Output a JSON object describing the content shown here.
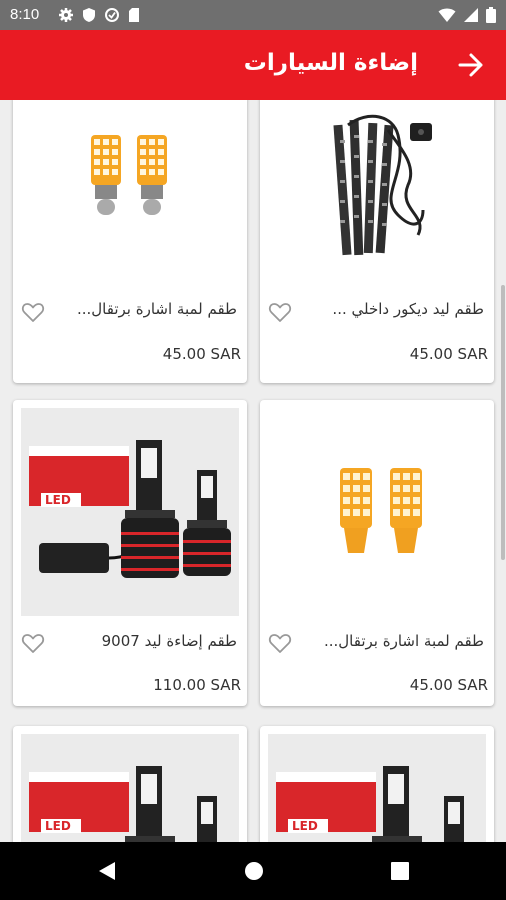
{
  "status": {
    "time": "8:10"
  },
  "header": {
    "title": "إضاءة السيارات"
  },
  "products": [
    {
      "name": "طقم ليد ديكور داخلي ...",
      "price": "45.00 SAR",
      "image": "led-strip-kit"
    },
    {
      "name": "طقم لمبة اشارة برتقال...",
      "price": "45.00 SAR",
      "image": "orange-signal-bulbs-1156"
    },
    {
      "name": "طقم لمبة اشارة برتقال...",
      "price": "45.00 SAR",
      "image": "orange-signal-bulbs-7440"
    },
    {
      "name": "طقم إضاءة ليد 9007",
      "price": "110.00 SAR",
      "image": "led-headlight-kit"
    },
    {
      "name": "",
      "price": "",
      "image": "led-headlight-kit"
    },
    {
      "name": "",
      "price": "",
      "image": "led-headlight-kit"
    }
  ],
  "colors": {
    "accent": "#e91b23",
    "status_bar": "#6f6f6f"
  }
}
